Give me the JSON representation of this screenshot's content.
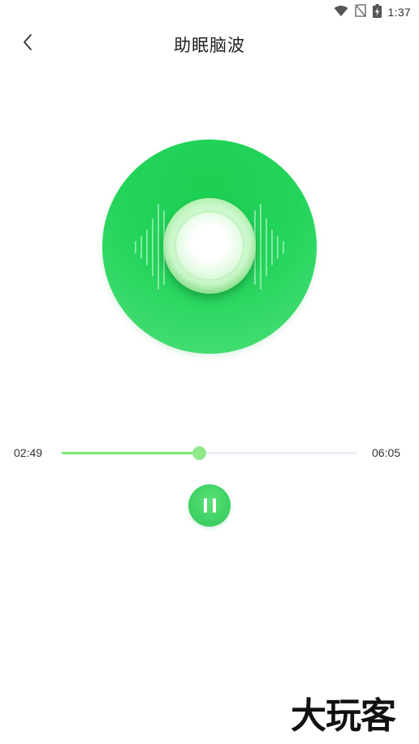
{
  "status_bar": {
    "time": "1:37",
    "icons": [
      "wifi-icon",
      "no-sim-icon",
      "battery-charging-icon"
    ]
  },
  "header": {
    "title": "助眠脑波",
    "back_icon": "chevron-left-icon"
  },
  "player": {
    "current_time": "02:49",
    "total_time": "06:05",
    "progress_fraction": 0.463,
    "state": "playing",
    "control_icon": "pause-icon",
    "accent_color": "#22d45a",
    "progress_color": "#7cea76"
  },
  "watermark": {
    "text": "大玩客"
  }
}
